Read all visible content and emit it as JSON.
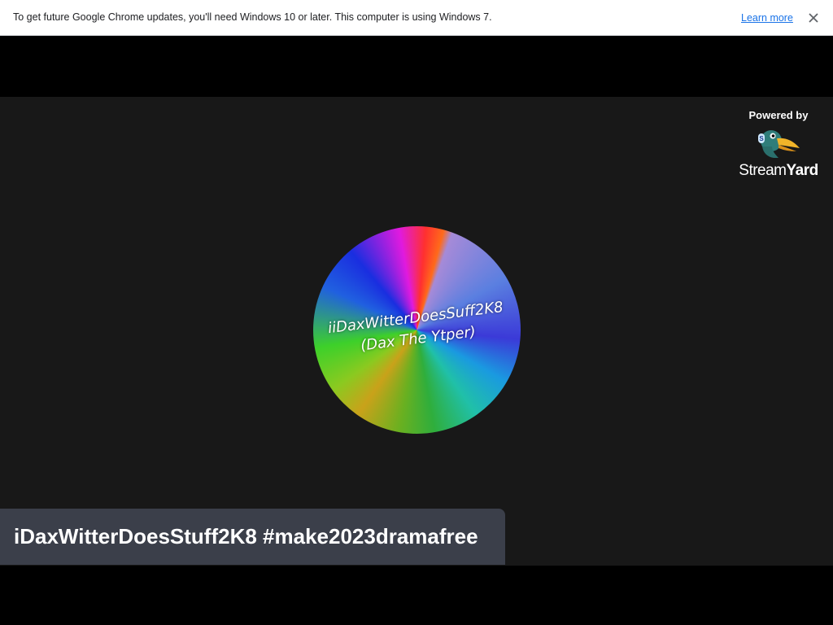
{
  "infobar": {
    "message": "To get future Google Chrome updates, you'll need Windows 10 or later. This computer is using Windows 7.",
    "link_label": "Learn more",
    "close_icon": "close-icon"
  },
  "stream": {
    "branding": {
      "powered_by": "Powered by",
      "wordmark_a": "Stream",
      "wordmark_b": "Yard",
      "logo_icon": "streamyard-duck-logo"
    },
    "avatar": {
      "line1": "iiDaxWitterDoesSuff2K8",
      "line2": "(Dax The Ytper)"
    },
    "name_banner": "iDaxWitterDoesStuff2K8 #make2023dramafree"
  },
  "colors": {
    "stage_bg": "#181818",
    "banner_bg": "#3b3f4a",
    "link": "#1a73e8"
  }
}
